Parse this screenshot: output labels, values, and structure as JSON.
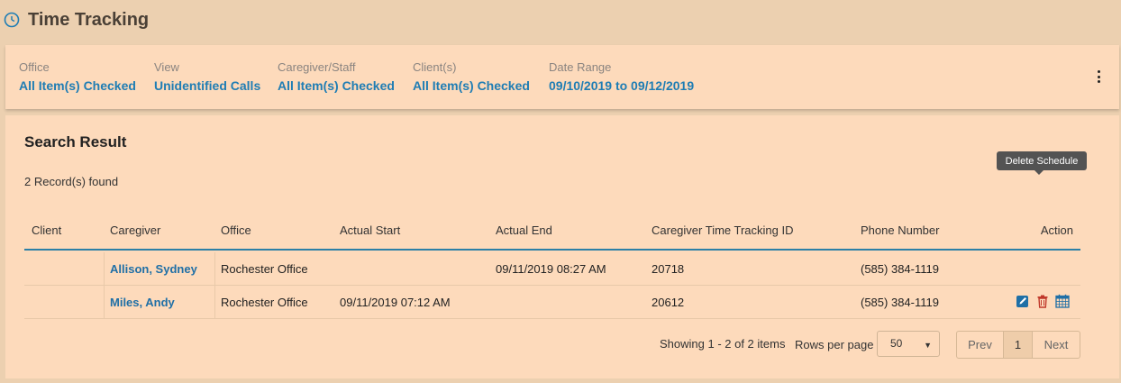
{
  "header": {
    "title": "Time Tracking"
  },
  "filters": [
    {
      "label": "Office",
      "value": "All Item(s) Checked"
    },
    {
      "label": "View",
      "value": "Unidentified Calls"
    },
    {
      "label": "Caregiver/Staff",
      "value": "All Item(s) Checked"
    },
    {
      "label": "Client(s)",
      "value": "All Item(s) Checked"
    },
    {
      "label": "Date Range",
      "value": "09/10/2019 to 09/12/2019"
    }
  ],
  "results": {
    "title": "Search Result",
    "records": "2 Record(s) found",
    "columns": [
      "Client",
      "Caregiver",
      "Office",
      "Actual Start",
      "Actual End",
      "Caregiver Time Tracking ID",
      "Phone Number",
      "Action"
    ],
    "rows": [
      {
        "client": "",
        "caregiver": "Allison, Sydney",
        "office": "Rochester Office",
        "start": "",
        "end": "09/11/2019 08:27 AM",
        "id": "20718",
        "phone": "(585) 384-1119"
      },
      {
        "client": "",
        "caregiver": "Miles, Andy",
        "office": "Rochester Office",
        "start": "09/11/2019 07:12 AM",
        "end": "",
        "id": "20612",
        "phone": "(585) 384-1119"
      }
    ]
  },
  "tooltip": "Delete Schedule",
  "pagination": {
    "showing": "Showing 1 - 2 of 2 items",
    "rows_label": "Rows per page",
    "rows_value": "50",
    "prev": "Prev",
    "page": "1",
    "next": "Next"
  },
  "colors": {
    "accent": "#1f7db4",
    "panel": "#fddabb",
    "background": "#ecd0b0"
  }
}
